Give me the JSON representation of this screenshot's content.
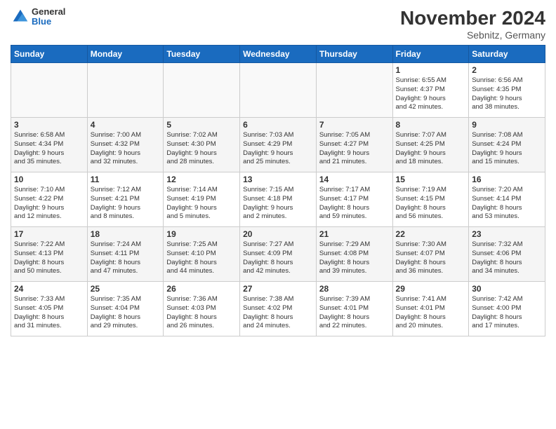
{
  "header": {
    "logo_general": "General",
    "logo_blue": "Blue",
    "month_title": "November 2024",
    "location": "Sebnitz, Germany"
  },
  "days_of_week": [
    "Sunday",
    "Monday",
    "Tuesday",
    "Wednesday",
    "Thursday",
    "Friday",
    "Saturday"
  ],
  "weeks": [
    [
      {
        "day": "",
        "info": ""
      },
      {
        "day": "",
        "info": ""
      },
      {
        "day": "",
        "info": ""
      },
      {
        "day": "",
        "info": ""
      },
      {
        "day": "",
        "info": ""
      },
      {
        "day": "1",
        "info": "Sunrise: 6:55 AM\nSunset: 4:37 PM\nDaylight: 9 hours\nand 42 minutes."
      },
      {
        "day": "2",
        "info": "Sunrise: 6:56 AM\nSunset: 4:35 PM\nDaylight: 9 hours\nand 38 minutes."
      }
    ],
    [
      {
        "day": "3",
        "info": "Sunrise: 6:58 AM\nSunset: 4:34 PM\nDaylight: 9 hours\nand 35 minutes."
      },
      {
        "day": "4",
        "info": "Sunrise: 7:00 AM\nSunset: 4:32 PM\nDaylight: 9 hours\nand 32 minutes."
      },
      {
        "day": "5",
        "info": "Sunrise: 7:02 AM\nSunset: 4:30 PM\nDaylight: 9 hours\nand 28 minutes."
      },
      {
        "day": "6",
        "info": "Sunrise: 7:03 AM\nSunset: 4:29 PM\nDaylight: 9 hours\nand 25 minutes."
      },
      {
        "day": "7",
        "info": "Sunrise: 7:05 AM\nSunset: 4:27 PM\nDaylight: 9 hours\nand 21 minutes."
      },
      {
        "day": "8",
        "info": "Sunrise: 7:07 AM\nSunset: 4:25 PM\nDaylight: 9 hours\nand 18 minutes."
      },
      {
        "day": "9",
        "info": "Sunrise: 7:08 AM\nSunset: 4:24 PM\nDaylight: 9 hours\nand 15 minutes."
      }
    ],
    [
      {
        "day": "10",
        "info": "Sunrise: 7:10 AM\nSunset: 4:22 PM\nDaylight: 9 hours\nand 12 minutes."
      },
      {
        "day": "11",
        "info": "Sunrise: 7:12 AM\nSunset: 4:21 PM\nDaylight: 9 hours\nand 8 minutes."
      },
      {
        "day": "12",
        "info": "Sunrise: 7:14 AM\nSunset: 4:19 PM\nDaylight: 9 hours\nand 5 minutes."
      },
      {
        "day": "13",
        "info": "Sunrise: 7:15 AM\nSunset: 4:18 PM\nDaylight: 9 hours\nand 2 minutes."
      },
      {
        "day": "14",
        "info": "Sunrise: 7:17 AM\nSunset: 4:17 PM\nDaylight: 8 hours\nand 59 minutes."
      },
      {
        "day": "15",
        "info": "Sunrise: 7:19 AM\nSunset: 4:15 PM\nDaylight: 8 hours\nand 56 minutes."
      },
      {
        "day": "16",
        "info": "Sunrise: 7:20 AM\nSunset: 4:14 PM\nDaylight: 8 hours\nand 53 minutes."
      }
    ],
    [
      {
        "day": "17",
        "info": "Sunrise: 7:22 AM\nSunset: 4:13 PM\nDaylight: 8 hours\nand 50 minutes."
      },
      {
        "day": "18",
        "info": "Sunrise: 7:24 AM\nSunset: 4:11 PM\nDaylight: 8 hours\nand 47 minutes."
      },
      {
        "day": "19",
        "info": "Sunrise: 7:25 AM\nSunset: 4:10 PM\nDaylight: 8 hours\nand 44 minutes."
      },
      {
        "day": "20",
        "info": "Sunrise: 7:27 AM\nSunset: 4:09 PM\nDaylight: 8 hours\nand 42 minutes."
      },
      {
        "day": "21",
        "info": "Sunrise: 7:29 AM\nSunset: 4:08 PM\nDaylight: 8 hours\nand 39 minutes."
      },
      {
        "day": "22",
        "info": "Sunrise: 7:30 AM\nSunset: 4:07 PM\nDaylight: 8 hours\nand 36 minutes."
      },
      {
        "day": "23",
        "info": "Sunrise: 7:32 AM\nSunset: 4:06 PM\nDaylight: 8 hours\nand 34 minutes."
      }
    ],
    [
      {
        "day": "24",
        "info": "Sunrise: 7:33 AM\nSunset: 4:05 PM\nDaylight: 8 hours\nand 31 minutes."
      },
      {
        "day": "25",
        "info": "Sunrise: 7:35 AM\nSunset: 4:04 PM\nDaylight: 8 hours\nand 29 minutes."
      },
      {
        "day": "26",
        "info": "Sunrise: 7:36 AM\nSunset: 4:03 PM\nDaylight: 8 hours\nand 26 minutes."
      },
      {
        "day": "27",
        "info": "Sunrise: 7:38 AM\nSunset: 4:02 PM\nDaylight: 8 hours\nand 24 minutes."
      },
      {
        "day": "28",
        "info": "Sunrise: 7:39 AM\nSunset: 4:01 PM\nDaylight: 8 hours\nand 22 minutes."
      },
      {
        "day": "29",
        "info": "Sunrise: 7:41 AM\nSunset: 4:01 PM\nDaylight: 8 hours\nand 20 minutes."
      },
      {
        "day": "30",
        "info": "Sunrise: 7:42 AM\nSunset: 4:00 PM\nDaylight: 8 hours\nand 17 minutes."
      }
    ]
  ]
}
